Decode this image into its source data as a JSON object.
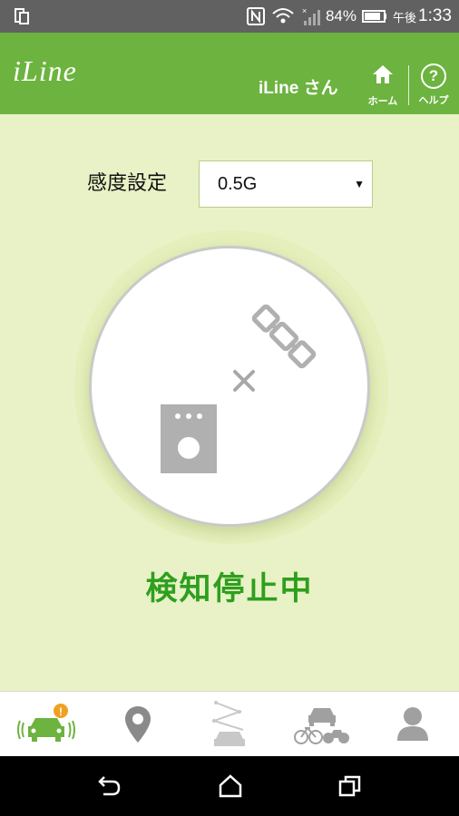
{
  "status_bar": {
    "battery": "84%",
    "time_prefix": "午後",
    "time": "1:33",
    "icons": [
      "sim-icon",
      "nfc-icon",
      "wifi-icon",
      "signal-icon",
      "battery-icon"
    ]
  },
  "app_bar": {
    "logo": "iLine",
    "user": "iLine さん",
    "home_label": "ホーム",
    "help_label": "ヘルプ",
    "color": "#6db33f"
  },
  "settings": {
    "sensitivity_label": "感度設定",
    "sensitivity_value": "0.5G"
  },
  "detector": {
    "status": "検知停止中",
    "status_color": "#2e9f1e",
    "icons": [
      "device-icon",
      "cross-icon",
      "satellite-icon"
    ]
  },
  "bottom_nav": {
    "tabs": [
      "car-alert",
      "location",
      "route",
      "vehicles",
      "account"
    ],
    "active": "car-alert",
    "alert_badge": "!"
  },
  "system_nav": [
    "back",
    "home",
    "recents"
  ]
}
